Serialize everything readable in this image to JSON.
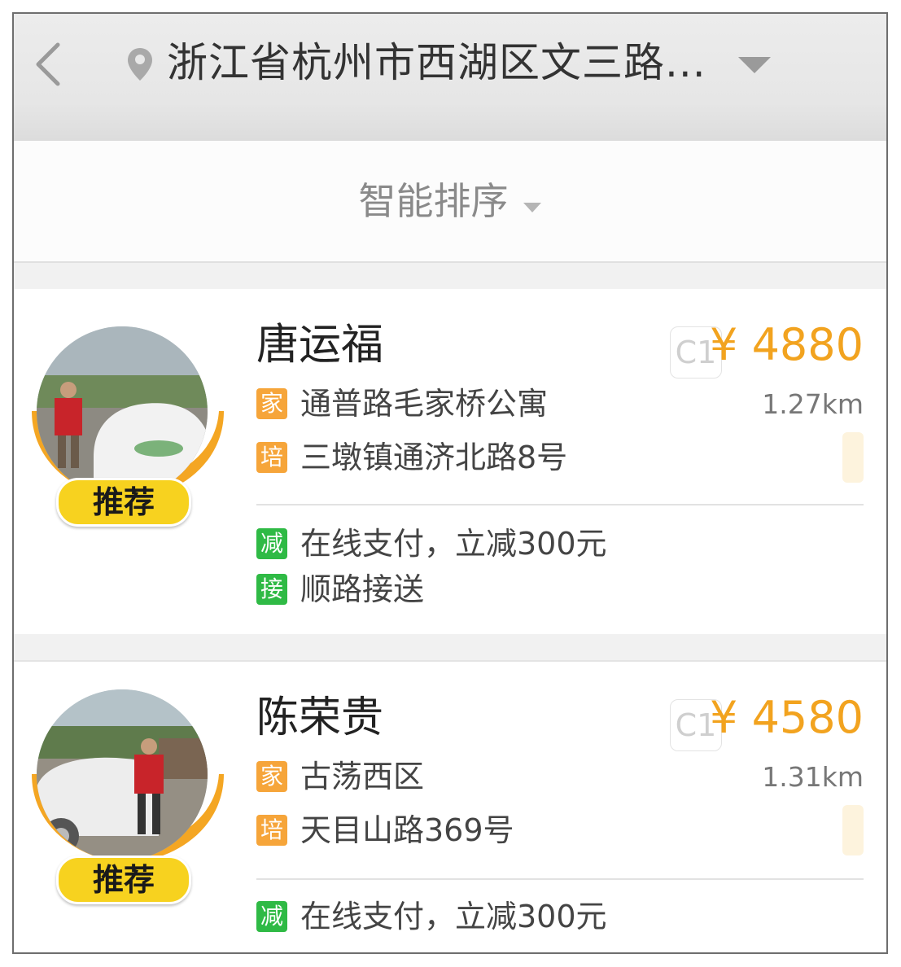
{
  "header": {
    "location": "浙江省杭州市西湖区文三路..."
  },
  "sort": {
    "label": "智能排序"
  },
  "colors": {
    "accent_price": "#f2a31f",
    "tag_orange": "#f6a53a",
    "tag_green": "#2fba45",
    "badge_yellow": "#f7d21f"
  },
  "instructors": [
    {
      "name": "唐运福",
      "license": "C1",
      "price": "¥ 4880",
      "badge": "推荐",
      "home_tag": "家",
      "home": "通普路毛家桥公寓",
      "distance": "1.27km",
      "train_tag": "培",
      "training": "三墩镇通济北路8号",
      "perks": [
        {
          "tag": "减",
          "text": "在线支付，立减300元"
        },
        {
          "tag": "接",
          "text": "顺路接送"
        }
      ]
    },
    {
      "name": "陈荣贵",
      "license": "C1",
      "price": "¥ 4580",
      "badge": "推荐",
      "home_tag": "家",
      "home": "古荡西区",
      "distance": "1.31km",
      "train_tag": "培",
      "training": "天目山路369号",
      "perks": [
        {
          "tag": "减",
          "text": "在线支付，立减300元"
        }
      ]
    }
  ]
}
